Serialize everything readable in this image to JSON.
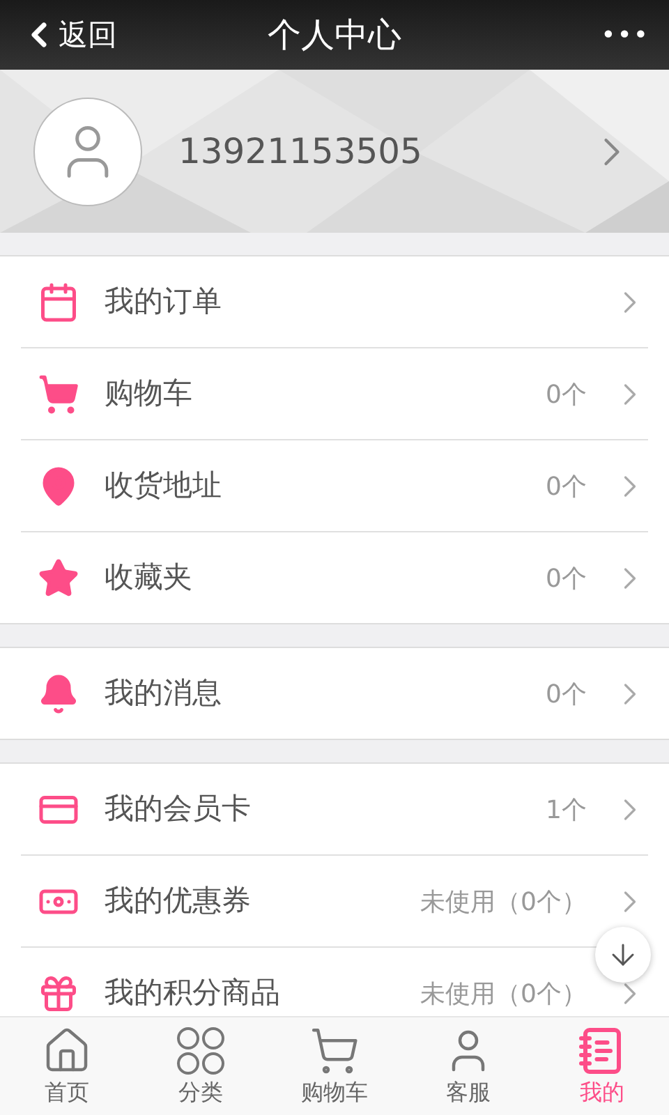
{
  "header": {
    "back": "返回",
    "title": "个人中心",
    "more": "•••"
  },
  "profile": {
    "phone": "13921153505"
  },
  "groups": [
    {
      "items": [
        {
          "kind": "calendar",
          "label": "我的订单"
        },
        {
          "kind": "cart",
          "label": "购物车",
          "count": "0个"
        },
        {
          "kind": "pin",
          "label": "收货地址",
          "count": "0个"
        },
        {
          "kind": "star",
          "label": "收藏夹",
          "count": "0个"
        }
      ]
    },
    {
      "items": [
        {
          "kind": "bell",
          "label": "我的消息",
          "count": "0个"
        }
      ]
    },
    {
      "items": [
        {
          "kind": "card",
          "label": "我的会员卡",
          "count": "1个"
        },
        {
          "kind": "banknote",
          "label": "我的优惠券",
          "count": "未使用（0个）"
        },
        {
          "kind": "gift",
          "label": "我的积分商品",
          "count": "未使用（0个）"
        }
      ]
    }
  ],
  "tabs": [
    {
      "kind": "home",
      "label": "首页",
      "selected": false
    },
    {
      "kind": "grid",
      "label": "分类",
      "selected": false
    },
    {
      "kind": "cart",
      "label": "购物车",
      "selected": false
    },
    {
      "kind": "user",
      "label": "客服",
      "selected": false
    },
    {
      "kind": "notebook",
      "label": "我的",
      "selected": true
    }
  ]
}
